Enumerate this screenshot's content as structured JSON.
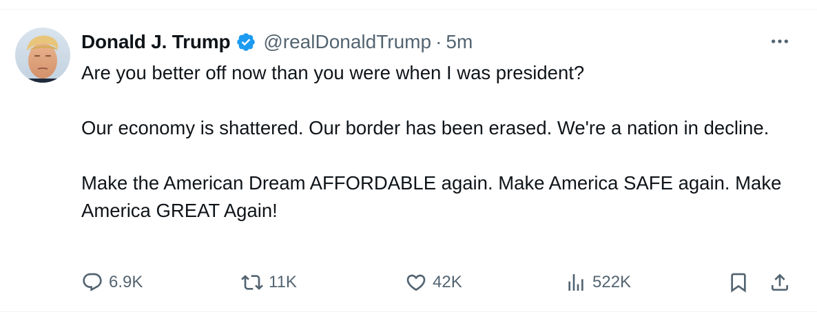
{
  "author": {
    "name": "Donald J. Trump",
    "handle": "@realDonaldTrump",
    "separator": "·",
    "time": "5m",
    "avatar_alt": "Donald J. Trump avatar"
  },
  "tweet": {
    "paragraphs": [
      "Are you better off now than you were when I was president?",
      "Our economy is shattered. Our border has been erased. We're a nation in decline.",
      "Make the American Dream AFFORDABLE again. Make America SAFE again. Make America GREAT Again!"
    ]
  },
  "actions": {
    "replies": "6.9K",
    "reposts": "11K",
    "likes": "42K",
    "views": "522K"
  },
  "icons": {
    "verified": "verified-badge-icon",
    "more": "more-horizontal-icon",
    "reply": "reply-icon",
    "repost": "repost-icon",
    "like": "heart-icon",
    "views": "views-chart-icon",
    "bookmark": "bookmark-icon",
    "share": "share-icon"
  },
  "colors": {
    "text_primary": "#0f1419",
    "text_secondary": "#536471",
    "verified_blue": "#1d9bf0",
    "divider": "#eff3f4"
  }
}
